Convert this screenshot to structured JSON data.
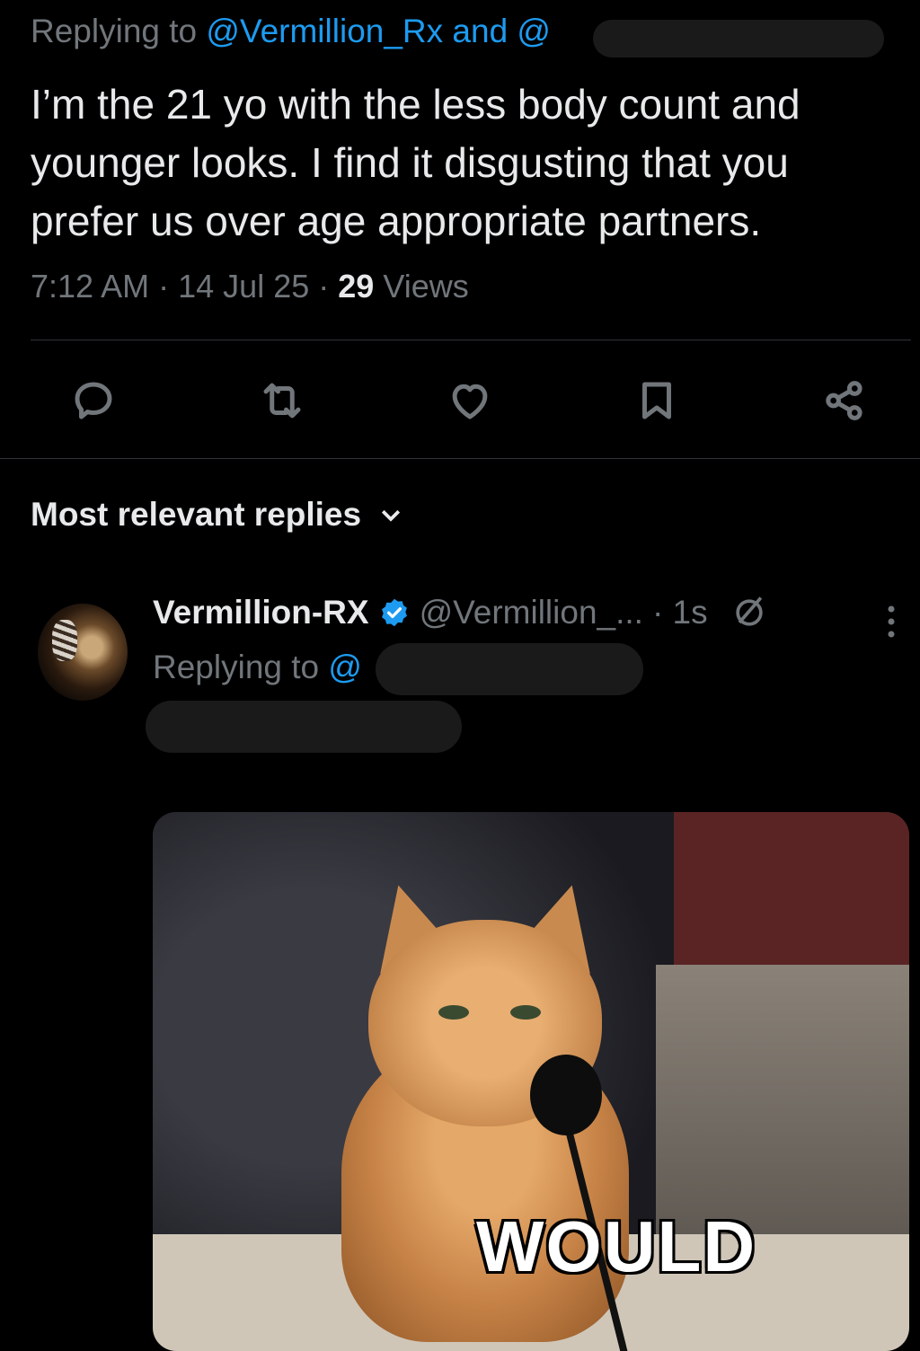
{
  "tweet": {
    "replying_prefix": "Replying to ",
    "replying_handles": "@Vermillion_Rx and @",
    "text": "I’m the 21 yo with the less body count and younger looks. I find it disgusting that you prefer us over age appropriate partners.",
    "time": "7:12 AM",
    "date": "14 Jul 25",
    "views_count": "29",
    "views_label": "Views",
    "separator": "·"
  },
  "actions": [
    "reply-icon",
    "retweet-icon",
    "like-icon",
    "bookmark-icon",
    "share-icon"
  ],
  "replies_header": {
    "label": "Most relevant replies"
  },
  "reply": {
    "display_name": "Vermillion-RX",
    "handle": "@Vermillion_...",
    "time": "· 1s",
    "replying_prefix": "Replying to ",
    "replying_handle": "@",
    "media_caption": "WOULD"
  },
  "colors": {
    "background": "#000000",
    "text": "#e7e9ea",
    "muted": "#71767b",
    "link": "#1d9bf0"
  }
}
